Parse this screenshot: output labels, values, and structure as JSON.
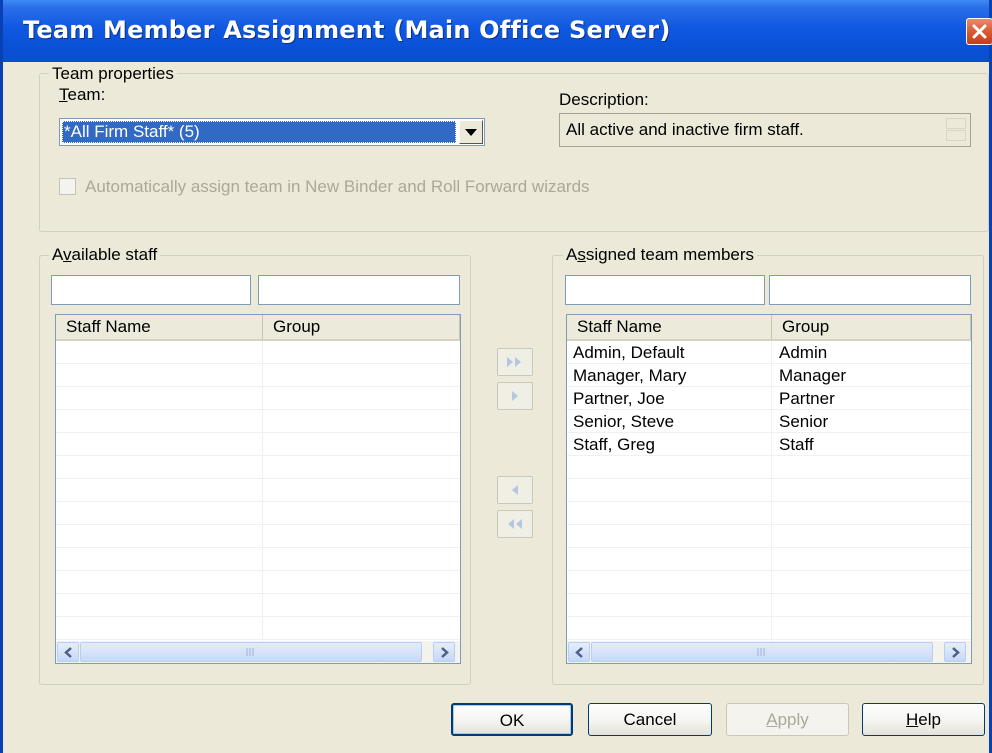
{
  "window": {
    "title": "Team Member Assignment  (Main Office Server)"
  },
  "team_properties": {
    "legend": "Team properties",
    "team_label": "Team:",
    "team_value": "*All Firm Staff* (5)",
    "description_label": "Description:",
    "description_value": "All active and inactive firm staff.",
    "auto_assign_label": "Automatically assign team in New Binder and Roll Forward wizards",
    "auto_assign_checked": false
  },
  "available": {
    "legend": "Available staff",
    "columns": [
      "Staff Name",
      "Group"
    ],
    "rows": []
  },
  "assigned": {
    "legend": "Assigned team members",
    "columns": [
      "Staff Name",
      "Group"
    ],
    "rows": [
      [
        "Admin, Default",
        "Admin"
      ],
      [
        "Manager, Mary",
        "Manager"
      ],
      [
        "Partner, Joe",
        "Partner"
      ],
      [
        "Senior, Steve",
        "Senior"
      ],
      [
        "Staff, Greg",
        "Staff"
      ]
    ]
  },
  "buttons": {
    "ok": "OK",
    "cancel": "Cancel",
    "apply": "Apply",
    "help": "Help"
  },
  "icons": [
    "close-icon",
    "dropdown-arrow-icon",
    "add-all-icon",
    "add-icon",
    "remove-icon",
    "remove-all-icon",
    "scroll-left-icon",
    "scroll-right-icon"
  ],
  "colors": {
    "titlebar": "#0a52d8",
    "selection": "#316ac5",
    "dialog": "#ece9d8"
  }
}
